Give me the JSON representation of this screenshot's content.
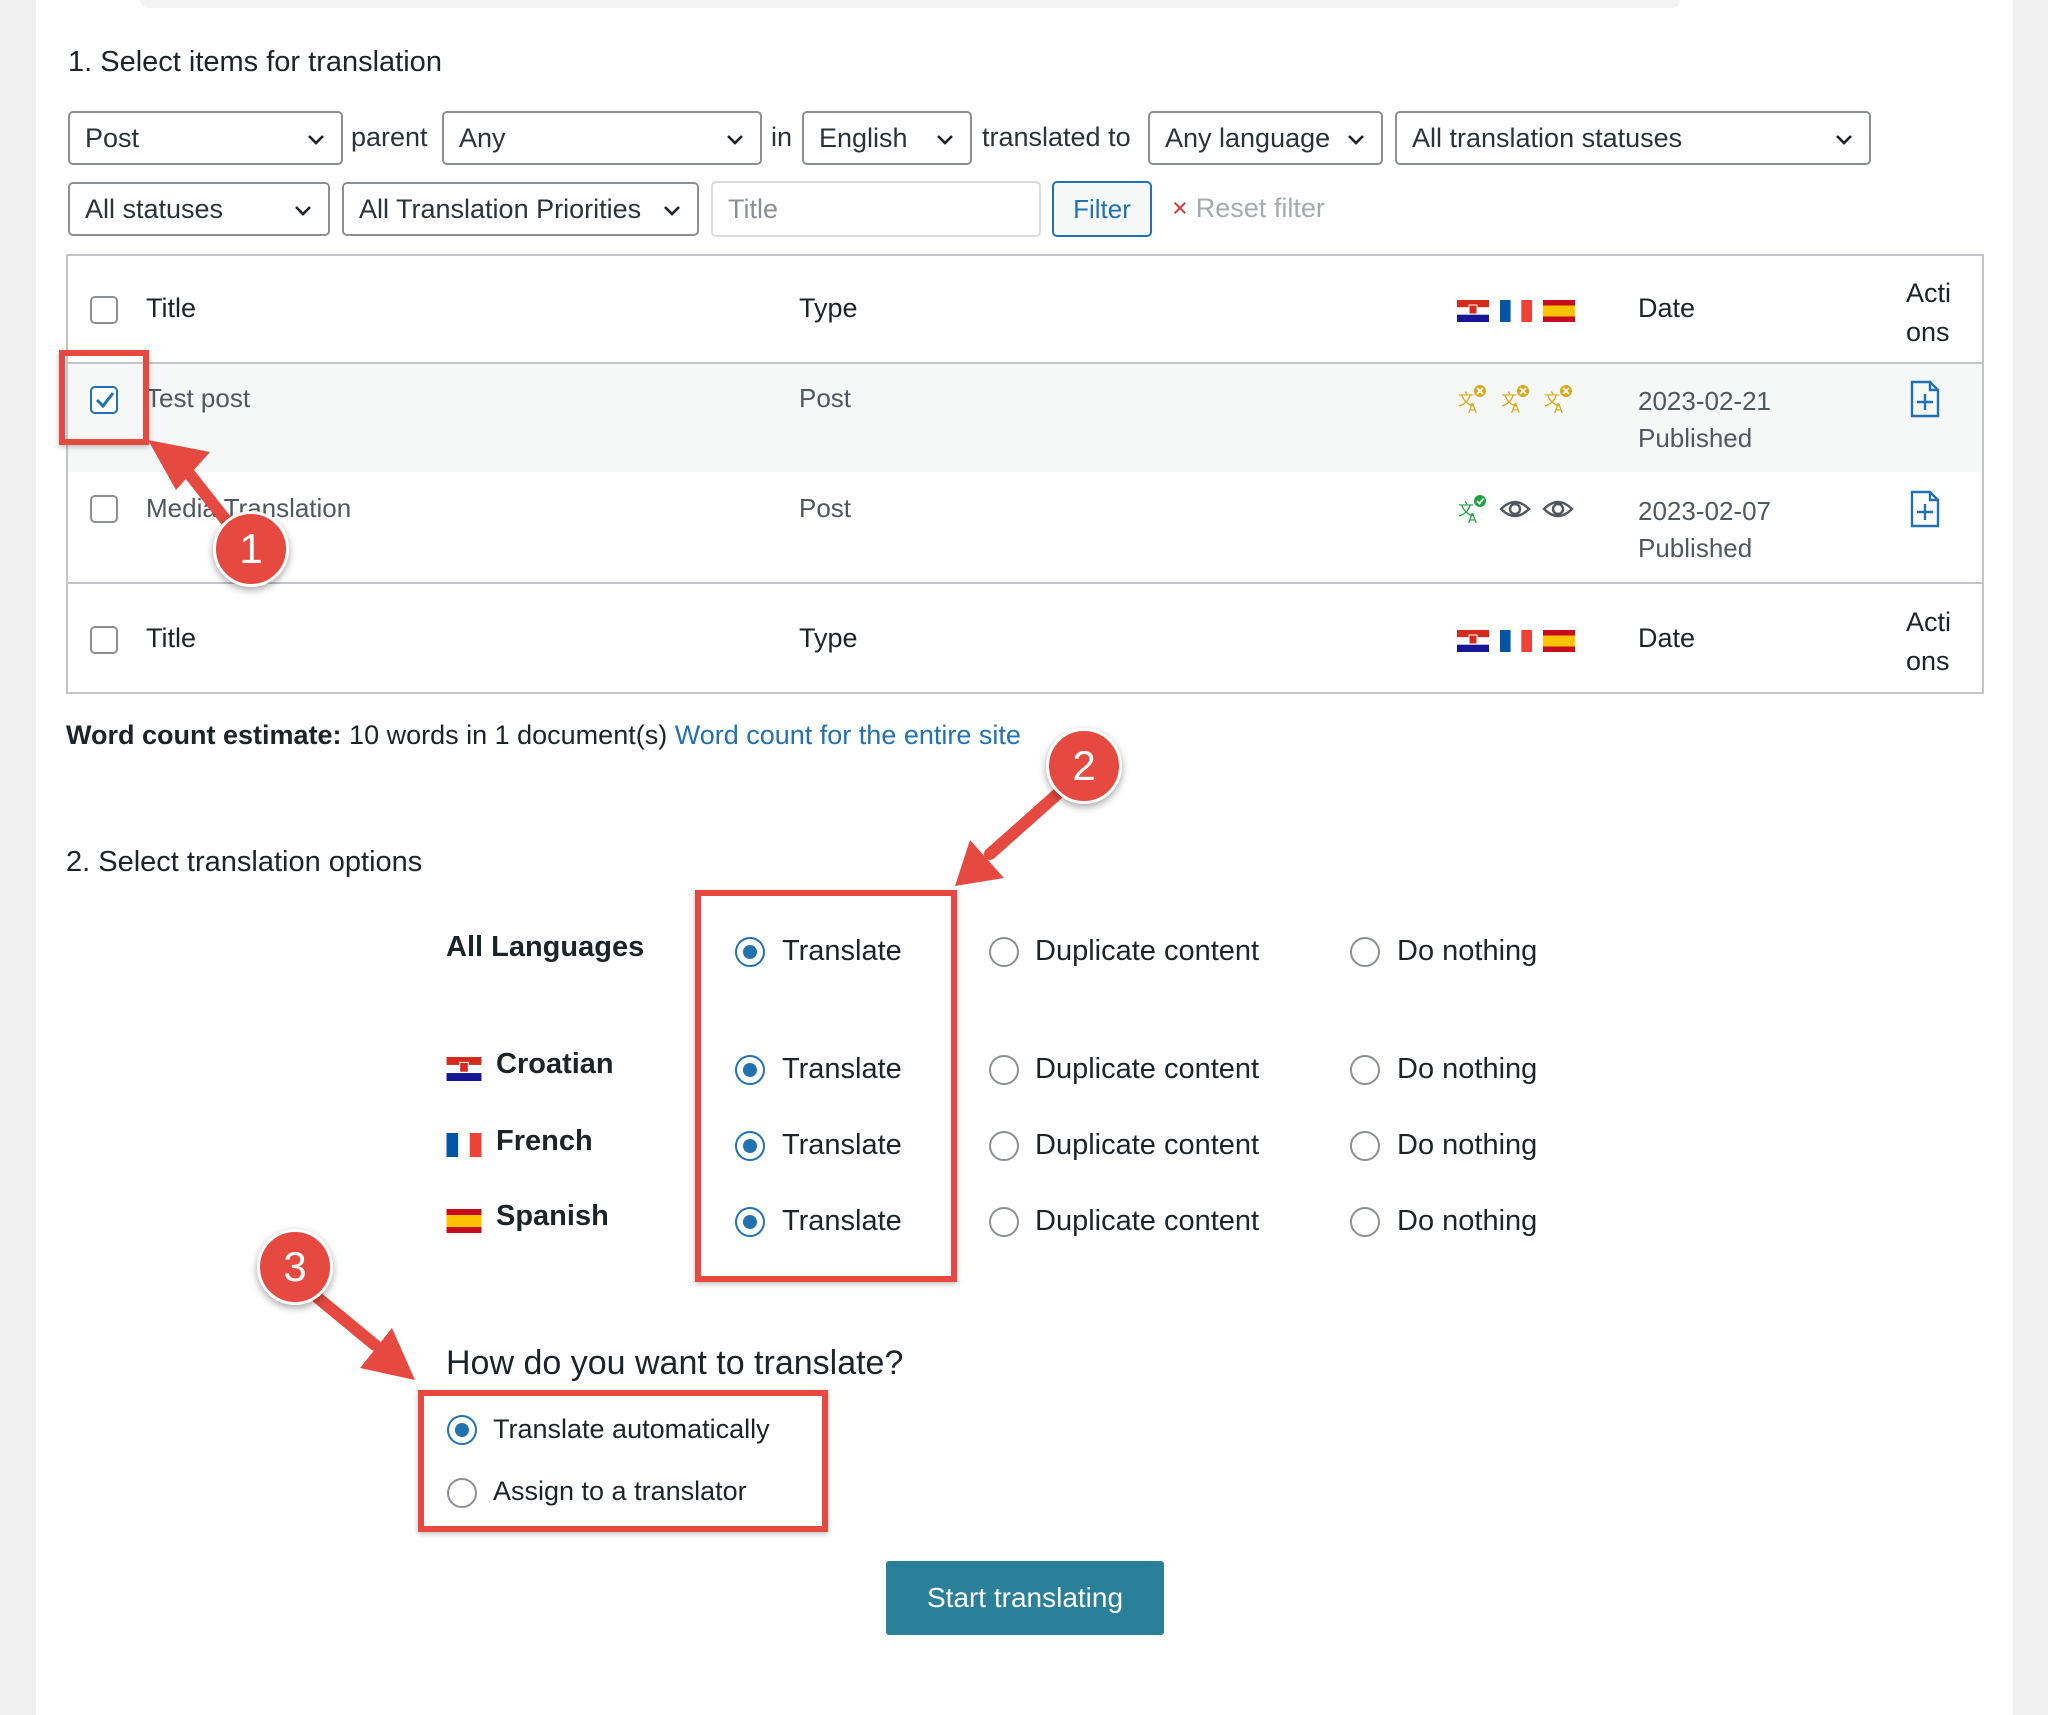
{
  "section1": {
    "heading": "1. Select items for translation"
  },
  "filters": {
    "post_type": "Post",
    "parent_label": "parent",
    "parent_value": "Any",
    "in_label": "in",
    "source_language": "English",
    "translated_to_label": "translated to",
    "target_language": "Any language",
    "translation_status": "All translation statuses",
    "post_status": "All statuses",
    "priority": "All Translation Priorities",
    "title_placeholder": "Title",
    "filter_button": "Filter",
    "reset_icon": "×",
    "reset_label": "Reset filter"
  },
  "table": {
    "headers": {
      "title": "Title",
      "type": "Type",
      "date": "Date",
      "actions_1": "Acti",
      "actions_2": "ons"
    },
    "rows": [
      {
        "title": "Test post",
        "type": "Post",
        "date": "2023-02-21",
        "status": "Published",
        "checked": true
      },
      {
        "title": "Media Translation",
        "type": "Post",
        "date": "2023-02-07",
        "status": "Published",
        "checked": false
      }
    ]
  },
  "word_count": {
    "label": "Word count estimate:",
    "text": "10 words in 1 document(s)",
    "link": "Word count for the entire site"
  },
  "section2": {
    "heading": "2. Select translation options"
  },
  "options": {
    "all_languages": "All Languages",
    "translate": "Translate",
    "duplicate": "Duplicate content",
    "nothing": "Do nothing",
    "languages": [
      "Croatian",
      "French",
      "Spanish"
    ]
  },
  "method": {
    "question": "How do you want to translate?",
    "auto": "Translate automatically",
    "assign": "Assign to a translator"
  },
  "start_button": "Start translating",
  "callouts": [
    "1",
    "2",
    "3"
  ],
  "colors": {
    "accent": "#2271b1",
    "annotation_red": "#e5493f",
    "start_button": "#2a7f99"
  }
}
